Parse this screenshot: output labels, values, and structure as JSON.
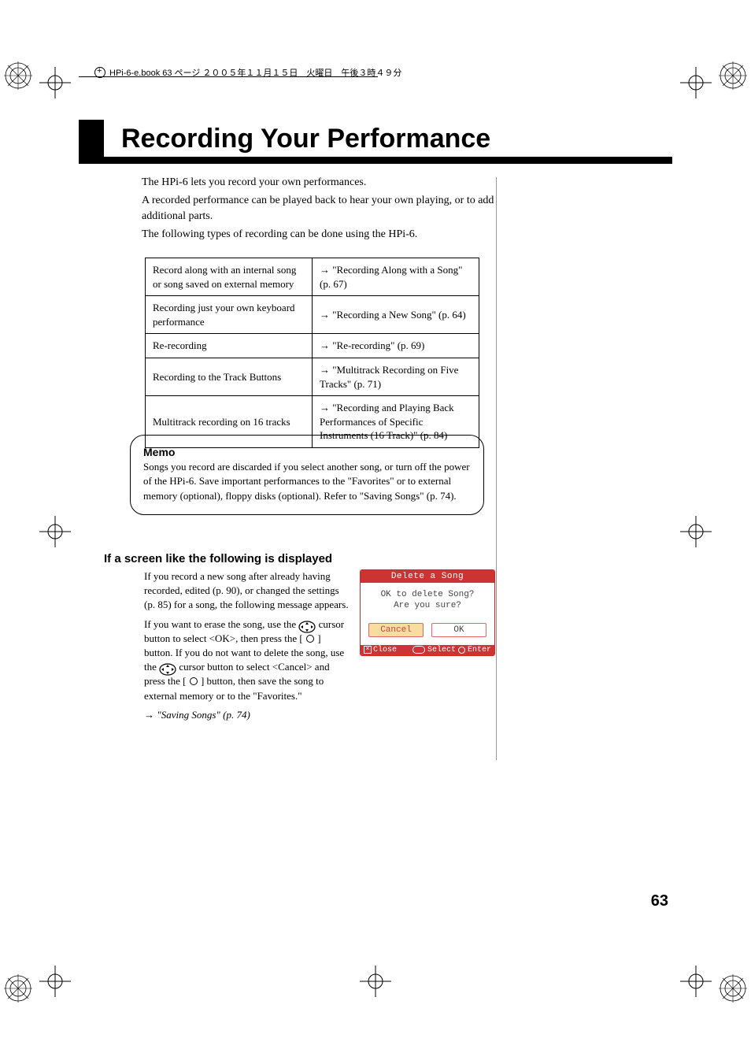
{
  "header_meta": "HPi-6-e.book 63 ページ ２００５年１１月１５日　火曜日　午後３時４９分",
  "title": "Recording Your Performance",
  "intro": {
    "p1": "The HPi-6 lets you record your own performances.",
    "p2": "A recorded performance can be played back to hear your own playing, or to add additional parts.",
    "p3": "The following types of recording can be done using the HPi-6."
  },
  "table": [
    {
      "left": "Record along with an internal song or song saved on external memory",
      "right": "→ \"Recording Along with a Song\" (p. 67)"
    },
    {
      "left": "Recording just your own keyboard performance",
      "right": "→ \"Recording a New Song\" (p. 64)"
    },
    {
      "left": "Re-recording",
      "right": "→ \"Re-recording\" (p. 69)"
    },
    {
      "left": "Recording to the Track Buttons",
      "right": "→ \"Multitrack Recording on Five Tracks\" (p. 71)"
    },
    {
      "left": "Multitrack recording on 16 tracks",
      "right": "→ \"Recording and Playing Back Performances of Specific Instruments (16 Track)\" (p. 84)"
    }
  ],
  "memo": {
    "heading": "Memo",
    "body": "Songs you record are discarded if you select another song, or turn off the power of the HPi-6. Save important performances to the \"Favorites\" or to external memory (optional), floppy disks (optional). Refer to \"Saving Songs\" (p. 74)."
  },
  "subheading": "If a screen like the following is displayed",
  "subbody": {
    "p1": "If you record a new song after already having recorded, edited (p. 90), or changed the settings (p. 85) for a song, the following message appears.",
    "p2a": "If you want to erase the song, use the ",
    "p2b": " cursor button to select <OK>, then press the [ ",
    "p2c": " ] button. If you do not want to delete the song, use the ",
    "p2d": " cursor button to select <Cancel> and press the [ ",
    "p2e": " ] button, then save the song to external memory or to the \"Favorites.\"",
    "xref": "→ \"Saving Songs\" (p. 74)"
  },
  "dialog": {
    "title": "Delete a Song",
    "line1": "OK to delete Song?",
    "line2": "Are you sure?",
    "cancel": "Cancel",
    "ok": "OK",
    "close": "Close",
    "select": "Select",
    "enter": "Enter"
  },
  "page_no": "63"
}
